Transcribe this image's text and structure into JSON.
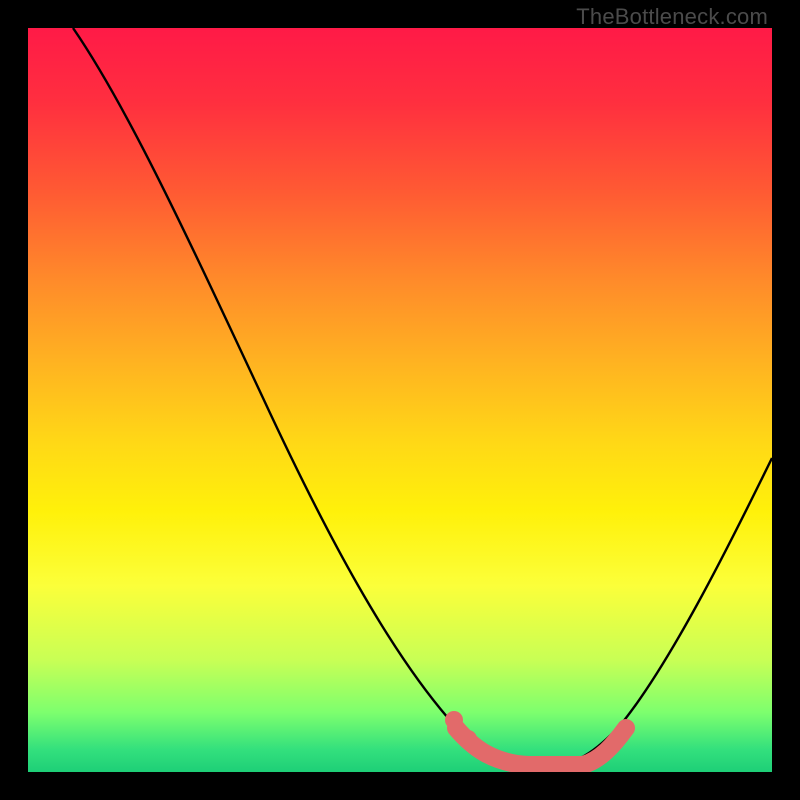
{
  "watermark": "TheBottleneck.com",
  "colors": {
    "background": "#000000",
    "curve": "#000000",
    "marker": "#e26a6a",
    "gradient_top": "#ff1a47",
    "gradient_mid": "#ffe012",
    "gradient_bottom": "#1ecf77"
  },
  "chart_data": {
    "type": "line",
    "title": "",
    "xlabel": "",
    "ylabel": "",
    "xlim": [
      0,
      100
    ],
    "ylim": [
      0,
      100
    ],
    "grid": false,
    "legend": false,
    "series": [
      {
        "name": "bottleneck-curve",
        "x": [
          6,
          12,
          20,
          28,
          36,
          44,
          52,
          56,
          59,
          62,
          66,
          70,
          74,
          78,
          82,
          88,
          94,
          100
        ],
        "y": [
          100,
          92,
          79,
          65,
          50,
          35,
          21,
          13,
          8,
          4,
          1,
          0,
          0,
          2,
          6,
          15,
          28,
          42
        ]
      }
    ],
    "markers": [
      {
        "name": "highlight-band",
        "approx_x_range": [
          58,
          78
        ],
        "approx_y": 0,
        "note": "flat minimum region emphasized with thick salmon stroke and two dots"
      }
    ]
  }
}
